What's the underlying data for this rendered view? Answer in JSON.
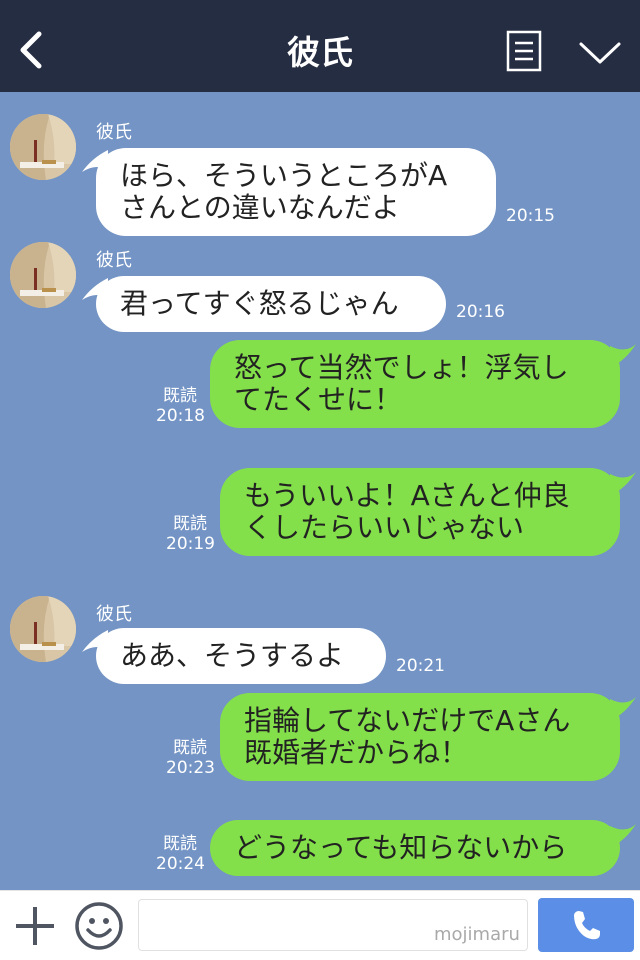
{
  "header": {
    "title": "彼氏",
    "back_icon": "chevron-left-icon",
    "menu_icon": "document-icon",
    "down_icon": "chevron-down-icon",
    "bg_color": "#252d42"
  },
  "chat": {
    "bg_color": "#7394c4",
    "messages": [
      {
        "side": "in",
        "sender": "彼氏",
        "lines": [
          "ほら、そういうところがA",
          "さんとの違いなんだよ"
        ],
        "time": "20:15"
      },
      {
        "side": "in",
        "sender": "彼氏",
        "lines": [
          "君ってすぐ怒るじゃん"
        ],
        "time": "20:16"
      },
      {
        "side": "out",
        "read": "既読",
        "lines": [
          "怒って当然でしょ！浮気し",
          "てたくせに！"
        ],
        "time": "20:18"
      },
      {
        "side": "out",
        "read": "既読",
        "lines": [
          "もういいよ！Aさんと仲良",
          "くしたらいいじゃない"
        ],
        "time": "20:19"
      },
      {
        "side": "in",
        "sender": "彼氏",
        "lines": [
          "ああ、そうするよ"
        ],
        "time": "20:21"
      },
      {
        "side": "out",
        "read": "既読",
        "lines": [
          "指輪してないだけでAさん",
          "既婚者だからね！"
        ],
        "time": "20:23"
      },
      {
        "side": "out",
        "read": "既読",
        "lines": [
          "どうなっても知らないから"
        ],
        "time": "20:24"
      }
    ]
  },
  "input_bar": {
    "plus_icon": "plus-icon",
    "emoji_icon": "smiley-icon",
    "send_icon": "phone-icon",
    "watermark": "mojimaru",
    "send_color": "#5b8ee6"
  }
}
